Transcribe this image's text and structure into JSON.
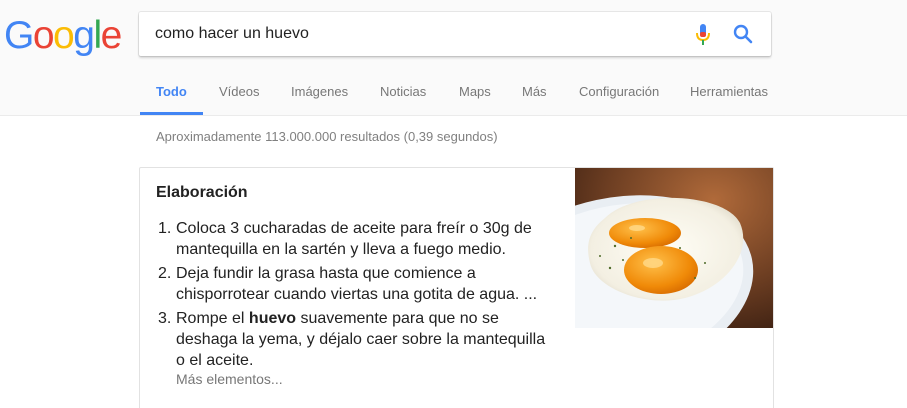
{
  "logo": {
    "letters": [
      "G",
      "o",
      "o",
      "g",
      "l",
      "e"
    ],
    "colors": [
      "#4285F4",
      "#EA4335",
      "#FBBC05",
      "#4285F4",
      "#34A853",
      "#EA4335"
    ]
  },
  "search": {
    "query": "como hacer un huevo",
    "mic_icon": "mic-icon",
    "search_icon": "search-icon"
  },
  "tabs": [
    "Todo",
    "Vídeos",
    "Imágenes",
    "Noticias",
    "Maps",
    "Más",
    "Configuración",
    "Herramientas"
  ],
  "active_tab": "Todo",
  "stats": "Aproximadamente 113.000.000 resultados (0,39 segundos)",
  "snippet": {
    "title": "Elaboración",
    "steps": [
      {
        "num": "1.",
        "lines": [
          "Coloca 3 cucharadas de aceite para freír o 30g de",
          "mantequilla en la sartén y lleva a fuego medio."
        ]
      },
      {
        "num": "2.",
        "lines": [
          "Deja fundir la grasa hasta que comience a",
          "chisporrotear cuando viertas una gotita de agua. ..."
        ]
      },
      {
        "num": "3.",
        "pre": "Rompe el ",
        "bold": "huevo",
        "post": " suavemente para que no se",
        "lines": [
          "deshaga la yema, y déjalo caer sobre la mantequilla",
          "o el aceite."
        ]
      }
    ],
    "more": "Más elementos...",
    "image_icon": "fried-egg-photo"
  },
  "colors": {
    "accent": "#4285F4",
    "stats": "#808080"
  }
}
